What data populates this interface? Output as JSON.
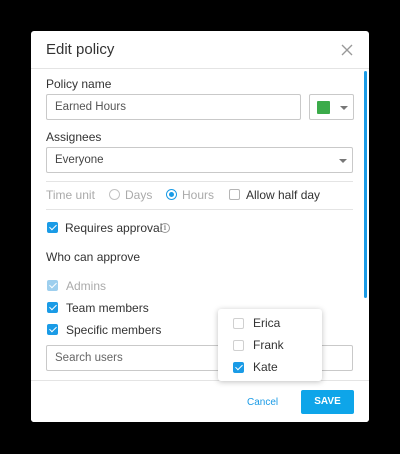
{
  "modal": {
    "title": "Edit policy",
    "close_icon": "close-icon"
  },
  "policy_name": {
    "label": "Policy name",
    "value": "Earned Hours",
    "color": "#3bab4a"
  },
  "assignees": {
    "label": "Assignees",
    "value": "Everyone"
  },
  "time_unit": {
    "label": "Time unit",
    "options": [
      {
        "label": "Days",
        "selected": false
      },
      {
        "label": "Hours",
        "selected": true
      }
    ],
    "allow_half_day": {
      "label": "Allow half day",
      "checked": false
    }
  },
  "requires_approval": {
    "label": "Requires approval",
    "checked": true,
    "info_icon": "info-icon"
  },
  "who_can_approve": {
    "label": "Who can approve",
    "options": [
      {
        "label": "Admins",
        "checked": true,
        "disabled": true
      },
      {
        "label": "Team members",
        "checked": true,
        "disabled": false
      },
      {
        "label": "Specific members",
        "checked": true,
        "disabled": false
      }
    ]
  },
  "search": {
    "placeholder": "Search users"
  },
  "users_dropdown": {
    "items": [
      {
        "label": "Erica",
        "checked": false
      },
      {
        "label": "Frank",
        "checked": false
      },
      {
        "label": "Kate",
        "checked": true
      }
    ]
  },
  "footer": {
    "cancel_label": "Cancel",
    "save_label": "SAVE"
  },
  "colors": {
    "accent": "#1a9be6",
    "save_button": "#0ea5e9"
  }
}
